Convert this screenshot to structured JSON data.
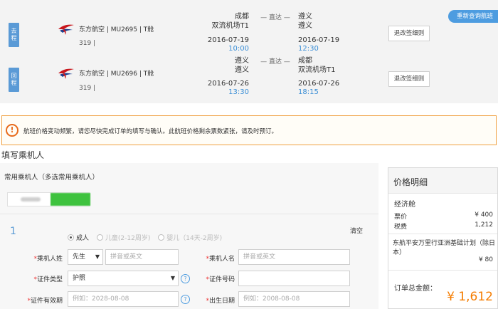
{
  "flight_summary": {
    "requery_label": "重新查询航班",
    "outbound": {
      "tag": "去程",
      "airline": "东方航空 | MU2695 | T舱",
      "model": "319 |",
      "dep_city": "成都",
      "dep_airport": "双流机场T1",
      "direct": "— 直达 —",
      "arr_city": "遵义",
      "arr_airport": "遵义",
      "dep_date": "2016-07-19",
      "dep_time": "10:00",
      "arr_date": "2016-07-19",
      "arr_time": "12:30",
      "rule_button": "退改签细则"
    },
    "return": {
      "tag": "回程",
      "airline": "东方航空 | MU2696 | T舱",
      "model": "319 |",
      "dep_city": "遵义",
      "dep_airport": "遵义",
      "direct": "— 直达 —",
      "arr_city": "成都",
      "arr_airport": "双流机场T1",
      "dep_date": "2016-07-26",
      "dep_time": "13:30",
      "arr_date": "2016-07-26",
      "arr_time": "18:15",
      "rule_button": "退改签细则"
    }
  },
  "notice": {
    "icon": "!",
    "text": "航班价格变动频繁，请您尽快完成订单的填写与确认。此航班价格剩余票数紧张，请及时预订。"
  },
  "passenger": {
    "section_title": "填写乘机人",
    "frequent_title": "常用乘机人（多选常用乘机人）",
    "index": "1",
    "clear_label": "清空",
    "types": [
      {
        "label": "成人",
        "selected": true
      },
      {
        "label": "儿童(2-12周岁)",
        "selected": false
      },
      {
        "label": "婴儿（14天-2周岁)",
        "selected": false
      }
    ],
    "fields": {
      "surname_label": "乘机人姓",
      "title_value": "先生",
      "surname_placeholder": "拼音或英文",
      "given_name_label": "乘机人名",
      "given_name_placeholder": "拼音或英文",
      "id_type_label": "证件类型",
      "id_type_value": "护照",
      "id_number_label": "证件号码",
      "expiry_label": "证件有效期",
      "expiry_placeholder": "例如：2028-08-08",
      "birth_label": "出生日期",
      "birth_placeholder": "例如：2008-08-08"
    }
  },
  "price_detail": {
    "title": "价格明细",
    "cabin": "经济舱",
    "fare_label": "票价",
    "fare_value": "¥ 400",
    "tax_label": "税费",
    "tax_value": "1,212",
    "insurance_name": "东航平安万里行亚洲基础计划（除日本）",
    "insurance_value": "¥ 80",
    "total_label": "订单总金额：",
    "total_value": "¥ 1,612"
  },
  "colors": {
    "accent_blue": "#4d9ce0",
    "time_blue": "#3a8ed6",
    "warning_orange": "#e86b1d",
    "total_orange": "#f57c00"
  }
}
